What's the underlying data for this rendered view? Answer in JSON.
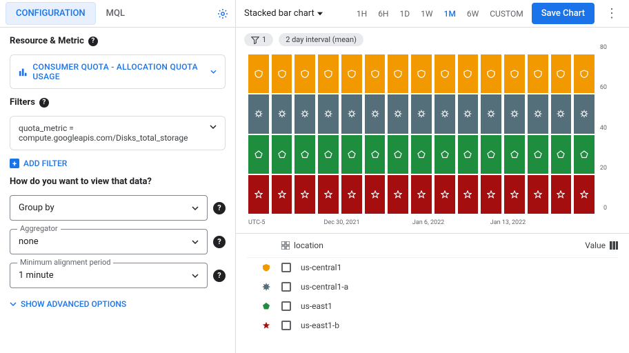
{
  "tabs": {
    "config": "CONFIGURATION",
    "mql": "MQL"
  },
  "sections": {
    "resource": "Resource & Metric",
    "filters": "Filters",
    "question": "How do you want to view that data?"
  },
  "metric_button": "CONSUMER QUOTA - ALLOCATION QUOTA USAGE",
  "filter_text": "quota_metric = compute.googleapis.com/Disks_total_storage",
  "add_filter": "ADD FILTER",
  "groupby": {
    "label": "",
    "value": "Group by"
  },
  "aggregator": {
    "label": "Aggregator",
    "value": "none"
  },
  "alignment": {
    "label": "Minimum alignment period",
    "value": "1 minute"
  },
  "advanced": "SHOW ADVANCED OPTIONS",
  "chart_type": "Stacked bar chart",
  "ranges": [
    "1H",
    "6H",
    "1D",
    "1W",
    "1M",
    "6W",
    "CUSTOM"
  ],
  "active_range": "1M",
  "save": "Save Chart",
  "chip1": "1",
  "chip2": "2 day interval (mean)",
  "legend": {
    "header": "location",
    "value": "Value",
    "items": [
      {
        "name": "us-central1",
        "color": "#f29900",
        "shape": "shield"
      },
      {
        "name": "us-central1-a",
        "color": "#546e7a",
        "shape": "burst"
      },
      {
        "name": "us-east1",
        "color": "#1e8e3e",
        "shape": "pentagon"
      },
      {
        "name": "us-east1-b",
        "color": "#a50e0e",
        "shape": "star"
      }
    ]
  },
  "chart_data": {
    "type": "bar",
    "stacked": true,
    "ylim": [
      0,
      80
    ],
    "yticks": [
      0,
      20,
      40,
      60,
      80
    ],
    "timezone": "UTC-5",
    "xticks": [
      {
        "pos": 27,
        "label": "Dec 30, 2021"
      },
      {
        "pos": 52,
        "label": "Jan 6, 2022"
      },
      {
        "pos": 75,
        "label": "Jan 13, 2022"
      }
    ],
    "n_bars": 15,
    "series": [
      {
        "name": "us-east1-b",
        "color": "#a50e0e",
        "shape": "star",
        "value": 20
      },
      {
        "name": "us-east1",
        "color": "#1e8e3e",
        "shape": "pentagon",
        "value": 20
      },
      {
        "name": "us-central1-a",
        "color": "#546e7a",
        "shape": "burst",
        "value": 20
      },
      {
        "name": "us-central1",
        "color": "#f29900",
        "shape": "shield",
        "value": 20
      }
    ]
  }
}
